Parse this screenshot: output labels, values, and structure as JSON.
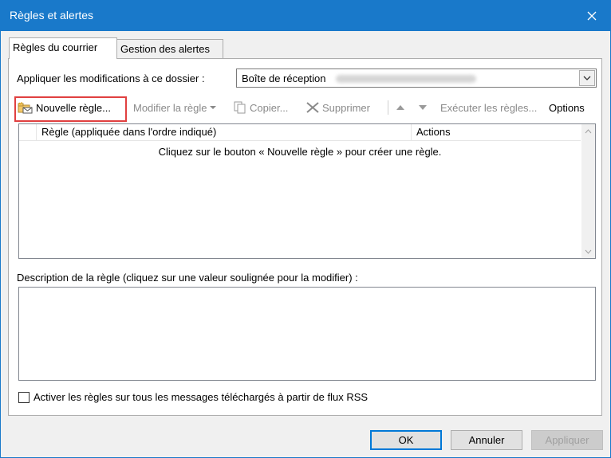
{
  "window": {
    "title": "Règles et alertes",
    "close_glyph": "✕"
  },
  "tabs": [
    {
      "label": "Règles du courrier",
      "active": true
    },
    {
      "label": "Gestion des alertes",
      "active": false
    }
  ],
  "folder": {
    "label": "Appliquer les modifications à ce dossier :",
    "value": "Boîte de réception"
  },
  "toolbar": {
    "new_rule": "Nouvelle règle...",
    "modify_rule": "Modifier la règle",
    "copy": "Copier...",
    "delete": "Supprimer",
    "run_rules": "Exécuter les règles...",
    "options": "Options"
  },
  "rules_list": {
    "columns": [
      "Règle (appliquée dans l'ordre indiqué)",
      "Actions"
    ],
    "empty_message": "Cliquez sur le bouton « Nouvelle règle » pour créer une règle."
  },
  "description": {
    "label": "Description de la règle (cliquez sur une valeur soulignée pour la modifier) :"
  },
  "rss_checkbox": {
    "label": "Activer les règles sur tous les messages téléchargés à partir de flux RSS",
    "checked": false
  },
  "buttons": {
    "ok": "OK",
    "cancel": "Annuler",
    "apply": "Appliquer"
  },
  "colors": {
    "titlebar": "#1979ca",
    "highlight": "#e04040",
    "default_button_border": "#0078d7"
  }
}
